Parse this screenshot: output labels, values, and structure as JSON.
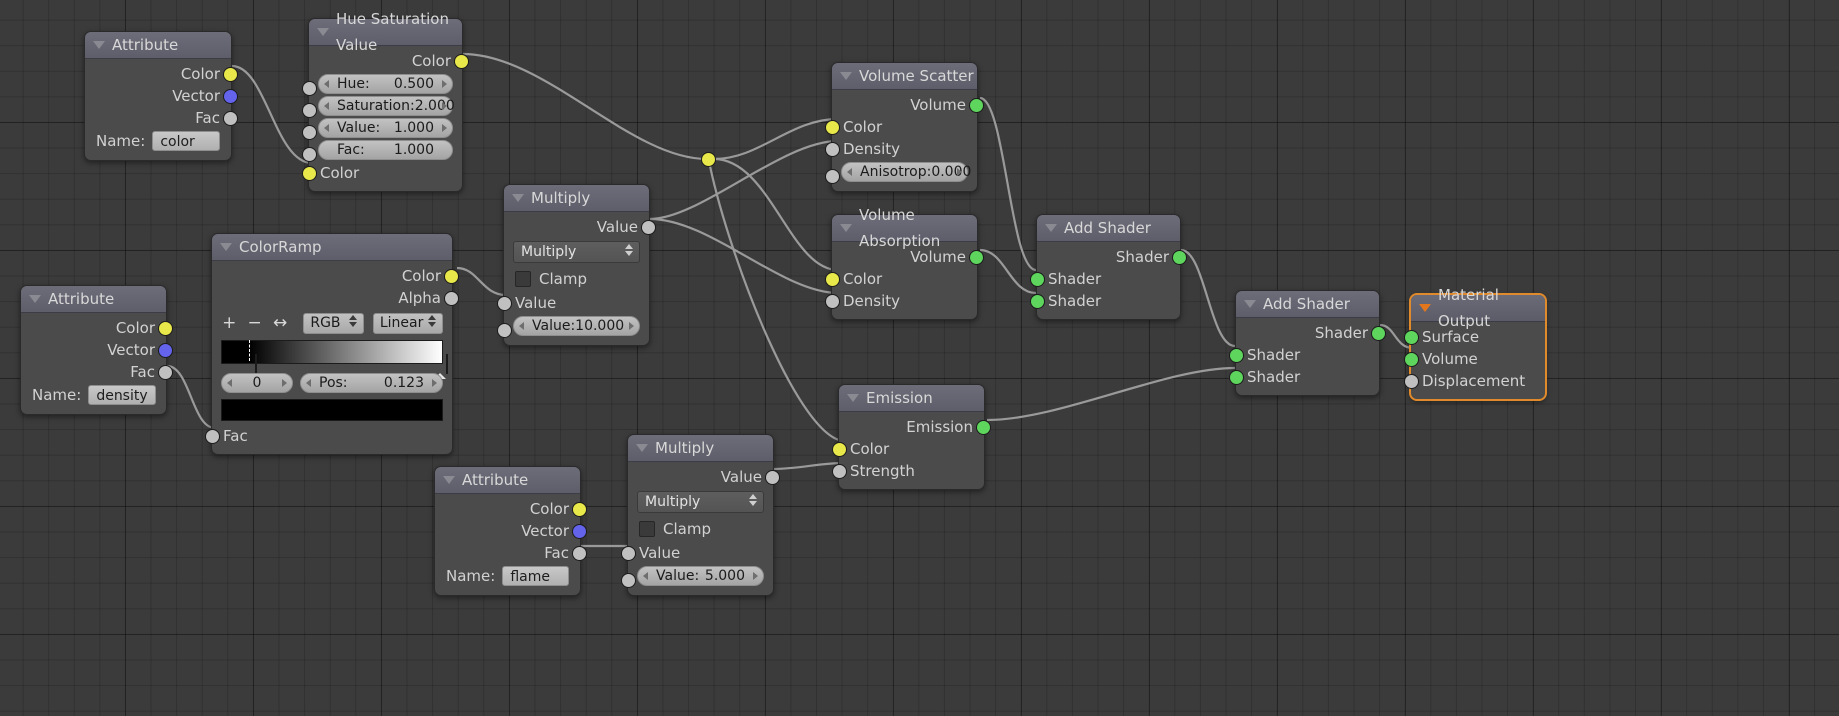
{
  "app": {
    "editor": "blender-node-editor"
  },
  "icons": {
    "collapse": "collapse-triangle",
    "add": "+",
    "remove": "−",
    "flip": "↔"
  },
  "sockets": {
    "color": "#e8e84a",
    "vector": "#6363ec",
    "value": "#c0c0c0",
    "shader": "#5ed65e"
  },
  "nodes": [
    {
      "id": "attribute-color",
      "title": "Attribute",
      "outputs": [
        "Color",
        "Vector",
        "Fac"
      ],
      "name_label": "Name:",
      "name_value": "color"
    },
    {
      "id": "hue-saturation-value",
      "title": "Hue Saturation Value",
      "outputs": [
        "Color"
      ],
      "fields": [
        {
          "label": "Hue:",
          "value": "0.500"
        },
        {
          "label": "Saturation:",
          "value": "2.000"
        },
        {
          "label": "Value:",
          "value": "1.000"
        },
        {
          "label": "Fac:",
          "value": "1.000"
        }
      ],
      "inputs": [
        "Color"
      ]
    },
    {
      "id": "colorramp",
      "title": "ColorRamp",
      "outputs": [
        "Color",
        "Alpha"
      ],
      "interpolation_color_mode": "RGB",
      "interpolation_mode": "Linear",
      "stop_index": "0",
      "pos_label": "Pos:",
      "pos_value": "0.123",
      "swatch_color": "#000000",
      "inputs": [
        "Fac"
      ]
    },
    {
      "id": "attribute-density",
      "title": "Attribute",
      "outputs": [
        "Color",
        "Vector",
        "Fac"
      ],
      "name_label": "Name:",
      "name_value": "density"
    },
    {
      "id": "multiply-10",
      "title": "Multiply",
      "outputs": [
        "Value"
      ],
      "operation": "Multiply",
      "clamp_label": "Clamp",
      "inputs": [
        "Value"
      ],
      "value_label": "Value:",
      "value_value": "10.000"
    },
    {
      "id": "attribute-flame",
      "title": "Attribute",
      "outputs": [
        "Color",
        "Vector",
        "Fac"
      ],
      "name_label": "Name:",
      "name_value": "flame"
    },
    {
      "id": "multiply-5",
      "title": "Multiply",
      "outputs": [
        "Value"
      ],
      "operation": "Multiply",
      "clamp_label": "Clamp",
      "inputs": [
        "Value"
      ],
      "value_label": "Value:",
      "value_value": "5.000"
    },
    {
      "id": "volume-scatter",
      "title": "Volume Scatter",
      "outputs": [
        "Volume"
      ],
      "inputs": [
        "Color",
        "Density"
      ],
      "aniso_label": "Anisotrop:",
      "aniso_value": "0.000"
    },
    {
      "id": "volume-absorption",
      "title": "Volume Absorption",
      "outputs": [
        "Volume"
      ],
      "inputs": [
        "Color",
        "Density"
      ]
    },
    {
      "id": "emission",
      "title": "Emission",
      "outputs": [
        "Emission"
      ],
      "inputs": [
        "Color",
        "Strength"
      ]
    },
    {
      "id": "add-shader-1",
      "title": "Add Shader",
      "outputs": [
        "Shader"
      ],
      "inputs": [
        "Shader",
        "Shader"
      ]
    },
    {
      "id": "add-shader-2",
      "title": "Add Shader",
      "outputs": [
        "Shader"
      ],
      "inputs": [
        "Shader",
        "Shader"
      ]
    },
    {
      "id": "material-output",
      "title": "Material Output",
      "inputs": [
        "Surface",
        "Volume",
        "Displacement"
      ],
      "selected": true
    }
  ]
}
